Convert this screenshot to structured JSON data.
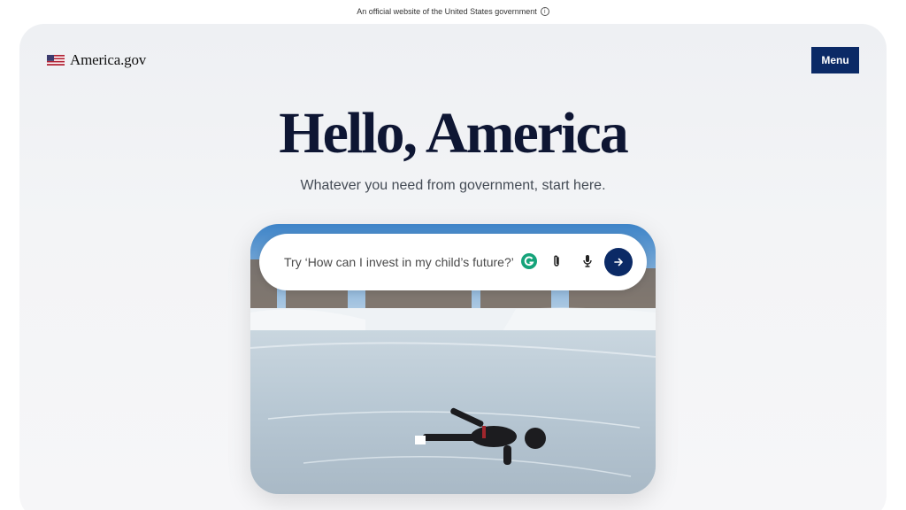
{
  "banner": {
    "text": "An official website of the United States government",
    "info_icon": "info-icon"
  },
  "header": {
    "logo_text": "America.gov",
    "flag_icon": "us-flag-icon",
    "menu_label": "Menu"
  },
  "hero": {
    "title": "Hello, America",
    "subtitle": "Whatever you need from government, start here."
  },
  "search": {
    "placeholder": "Try ‘How can I invest in my child’s future?’",
    "icons": [
      "grammarly-icon",
      "paperclip-icon",
      "microphone-icon",
      "arrow-right-icon"
    ]
  },
  "colors": {
    "primary_navy": "#0b2a66",
    "title_color": "#0e1633",
    "card_background": "#f1f2f4",
    "grammarly_green": "#15a37a"
  }
}
